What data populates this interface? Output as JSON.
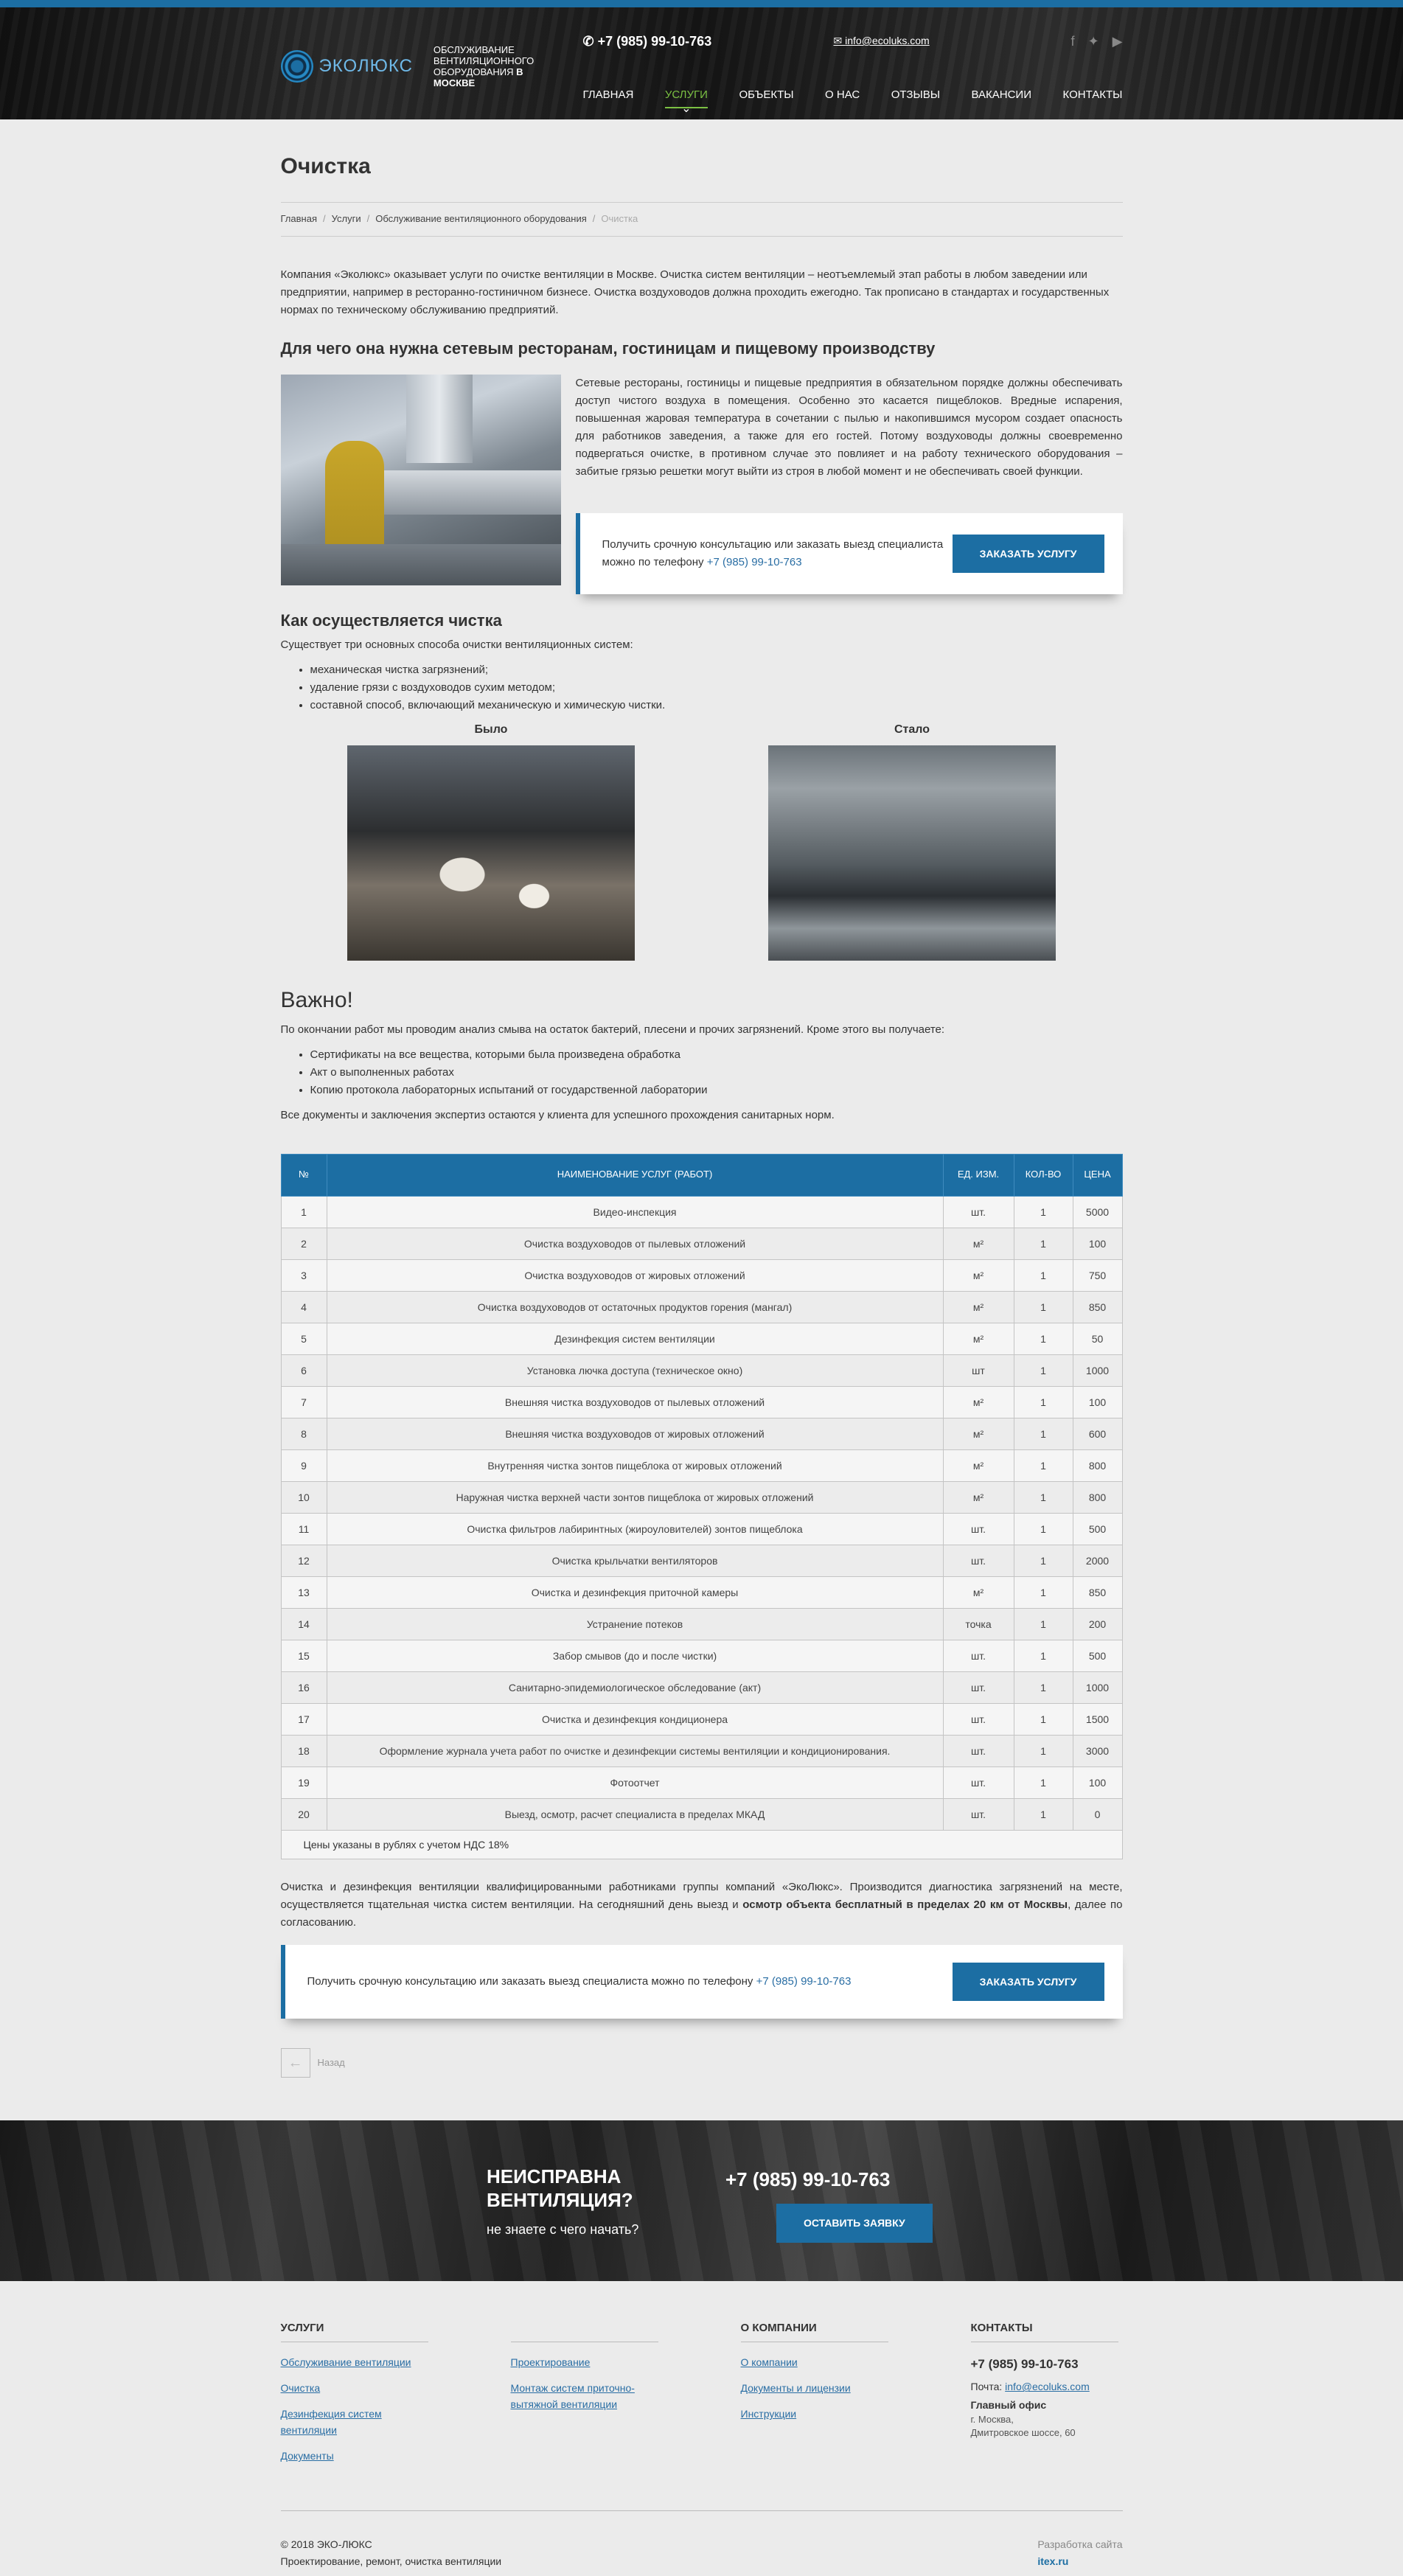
{
  "header": {
    "logo_text": "ЭКОЛЮКС",
    "logo_sub_1": "ОБСЛУЖИВАНИЕ ВЕНТИЛЯЦИОННОГО ОБОРУДОВАНИЯ",
    "logo_sub_2": "В МОСКВЕ",
    "phone": "+7 (985) 99-10-763",
    "email": "info@ecoluks.com",
    "nav": [
      "ГЛАВНАЯ",
      "УСЛУГИ",
      "ОБЪЕКТЫ",
      "О НАС",
      "ОТЗЫВЫ",
      "ВАКАНСИИ",
      "КОНТАКТЫ"
    ],
    "social": [
      "facebook-icon",
      "twitter-icon",
      "youtube-icon"
    ]
  },
  "page": {
    "title": "Очистка",
    "breadcrumbs": [
      "Главная",
      "Услуги",
      "Обслуживание вентиляционного оборудования",
      "Очистка"
    ],
    "intro": "Компания «Эколюкс» оказывает услуги по очистке вентиляции в Москве. Очистка систем вентиляции – неотъемлемый этап работы в любом заведении или предприятии, например в ресторанно-гостиничном бизнесе. Очистка воздуховодов должна проходить ежегодно. Так прописано в стандартах и государственных нормах по техническому обслуживанию предприятий.",
    "h2": "Для чего она нужна сетевым ресторанам, гостиницам и пищевому производству",
    "why_text": "Сетевые рестораны, гостиницы и пищевые предприятия в обязательном порядке должны обеспечивать доступ чистого воздуха в помещения. Особенно это касается пищеблоков. Вредные испарения, повышенная жаровая температура в сочетании с пылью и накопившимся мусором создает опасность для работников заведения, а также для его гостей. Потому воздуховоды должны своевременно подвергаться очистке, в противном случае это повлияет и на работу технического оборудования – забитые грязью решетки могут выйти из строя в любой момент и не обеспечивать своей функции.",
    "cta1_text": "Получить срочную консультацию или заказать выезд специалиста можно по телефону",
    "cta_phone": "+7 (985) 99-10-763",
    "cta1_btn": "ЗАКАЗАТЬ УСЛУГУ",
    "h3": "Как осуществляется чистка",
    "methods_intro": "Существует три основных способа очистки вентиляционных систем:",
    "methods": [
      "механическая чистка загрязнений;",
      "удаление грязи с воздуховодов сухим методом;",
      "составной способ, включающий механическую и химическую чистки."
    ],
    "before_label": "Было",
    "after_label": "Стало",
    "important_title": "Важно!",
    "important_text": "По окончании работ мы проводим анализ смыва на остаток бактерий, плесени и прочих загрязнений. Кроме этого вы получаете:",
    "important_list": [
      "Сертификаты на все вещества, которыми была произведена обработка",
      "Акт о выполненных работах",
      "Копию протокола лабораторных испытаний от государственной лаборатории"
    ],
    "important_footer": "Все документы и заключения экспертиз остаются у клиента для успешного прохождения санитарных норм.",
    "table_headers": [
      "№",
      "НАИМЕНОВАНИЕ УСЛУГ (РАБОТ)",
      "ЕД. ИЗМ.",
      "КОЛ-ВО",
      "ЦЕНА"
    ],
    "table_rows": [
      [
        "1",
        "Видео-инспекция",
        "шт.",
        "1",
        "5000"
      ],
      [
        "2",
        "Очистка воздуховодов от пылевых отложений",
        "м²",
        "1",
        "100"
      ],
      [
        "3",
        "Очистка воздуховодов от жировых отложений",
        "м²",
        "1",
        "750"
      ],
      [
        "4",
        "Очистка воздуховодов от остаточных продуктов горения (мангал)",
        "м²",
        "1",
        "850"
      ],
      [
        "5",
        "Дезинфекция систем вентиляции",
        "м²",
        "1",
        "50"
      ],
      [
        "6",
        "Установка лючка доступа (техническое окно)",
        "шт",
        "1",
        "1000"
      ],
      [
        "7",
        "Внешняя чистка воздуховодов от пылевых отложений",
        "м²",
        "1",
        "100"
      ],
      [
        "8",
        "Внешняя чистка воздуховодов от жировых отложений",
        "м²",
        "1",
        "600"
      ],
      [
        "9",
        "Внутренняя чистка зонтов пищеблока от жировых отложений",
        "м²",
        "1",
        "800"
      ],
      [
        "10",
        "Наружная чистка верхней части зонтов пищеблока от жировых отложений",
        "м²",
        "1",
        "800"
      ],
      [
        "11",
        "Очистка фильтров лабиринтных (жироуловителей) зонтов пищеблока",
        "шт.",
        "1",
        "500"
      ],
      [
        "12",
        "Очистка крыльчатки вентиляторов",
        "шт.",
        "1",
        "2000"
      ],
      [
        "13",
        "Очистка и дезинфекция приточной камеры",
        "м²",
        "1",
        "850"
      ],
      [
        "14",
        "Устранение потеков",
        "точка",
        "1",
        "200"
      ],
      [
        "15",
        "Забор смывов (до и после чистки)",
        "шт.",
        "1",
        "500"
      ],
      [
        "16",
        "Санитарно-эпидемиологическое обследование (акт)",
        "шт.",
        "1",
        "1000"
      ],
      [
        "17",
        "Очистка и дезинфекция кондиционера",
        "шт.",
        "1",
        "1500"
      ],
      [
        "18",
        "Оформление журнала учета работ по очистке и дезинфекции системы вентиляции и кондиционирования.",
        "шт.",
        "1",
        "3000"
      ],
      [
        "19",
        "Фотоотчет",
        "шт.",
        "1",
        "100"
      ],
      [
        "20",
        "Выезд, осмотр, расчет специалиста в пределах МКАД",
        "шт.",
        "1",
        "0"
      ]
    ],
    "table_note": "Цены указаны в рублях с учетом НДС 18%",
    "after_text_1": "Очистка и дезинфекция вентиляции квалифицированными работниками группы компаний «ЭкоЛюкс». Производится диагностика загрязнений на месте, осуществляется тщательная чистка систем вентиляции. На сегодняшний день выезд и",
    "after_text_bold": "осмотр объекта бесплатный в пределах 20 км от Москвы",
    "after_text_2": ", далее по согласованию.",
    "cta2_text": "Получить срочную консультацию или заказать выезд специалиста можно по телефону",
    "cta2_btn": "ЗАКАЗАТЬ УСЛУГУ",
    "back_label": "Назад"
  },
  "banner": {
    "title": "НЕИСПРАВНА ВЕНТИЛЯЦИЯ?",
    "subtitle": "не знаете с чего начать?",
    "phone": "+7 (985) 99-10-763",
    "button": "ОСТАВИТЬ ЗАЯВКУ"
  },
  "footer": {
    "services_title": "УСЛУГИ",
    "services_col1": [
      "Обслуживание вентиляции",
      "Очистка",
      "Дезинфекция систем вентиляции",
      "Документы"
    ],
    "services_col2": [
      "Проектирование",
      "Монтаж систем приточно-вытяжной вентиляции"
    ],
    "company_title": "О КОМПАНИИ",
    "company_links": [
      "О компании",
      "Документы и лицензии",
      "Инструкции"
    ],
    "contacts_title": "КОНТАКТЫ",
    "phone": "+7 (985) 99-10-763",
    "mail_label": "Почта:",
    "mail": "info@ecoluks.com",
    "office_title": "Главный офис",
    "office_city": "г. Москва,",
    "office_street": "Дмитровское шоссе, 60",
    "copyright": "© 2018 ЭКО-ЛЮКС",
    "tagline": "Проектирование, ремонт, очистка вентиляции",
    "dev_label": "Разработка сайта",
    "dev_name": "itex.ru"
  },
  "colors": {
    "accent": "#1c6ea3",
    "nav_active": "#7bc043",
    "page_bg": "#ebebeb"
  }
}
